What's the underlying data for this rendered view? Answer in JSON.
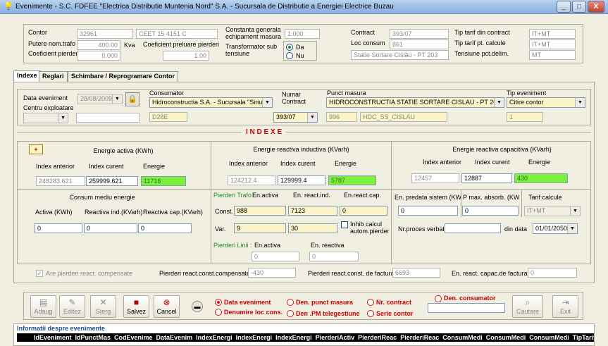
{
  "window": {
    "title": "Evenimente - S.C. FDFEE \"Electrica Distributie Muntenia Nord\" S.A. - Sucursala de Distributie a Energiei Electrice Buzau",
    "min": "_",
    "max": "□",
    "close": "X"
  },
  "top": {
    "contor_label": "Contor",
    "contor_value": "32961",
    "contor_desc": "CEET 15 4151 C",
    "putere_label": "Putere nom.trafo",
    "putere_value": "400.00",
    "putere_unit": "Kva",
    "coef_pierderi_label": "Coeficient pierderi",
    "coef_pierderi_value": "0.000",
    "coef_preluare_label": "Coeficient preluare pierderi",
    "coef_preluare_value": "1.00",
    "constanta_label": "Constanta generala echipament masura",
    "constanta_value": "1.000",
    "transformator_label": "Transformator sub tensiune",
    "da_label": "Da",
    "nu_label": "Nu",
    "contract_label": "Contract",
    "contract_value": "393/07",
    "loc_consum_label": "Loc consum",
    "loc_consum_value": "861",
    "loc_consum_desc": "Statie Sortare Cislău - PT 203",
    "tip_tarif_contract_label": "Tip tarif din contract",
    "tip_tarif_contract_value": "IT+MT",
    "tip_tarif_calcule_label": "Tip tarif pt. calcule",
    "tip_tarif_calcule_value": "IT+MT",
    "tensiune_label": "Tensiune pct.delim.",
    "tensiune_value": "MT"
  },
  "tabs": [
    "Indexe",
    "Reglari",
    "Schimbare / Reprogramare Contor"
  ],
  "event": {
    "data_label": "Data eveniment",
    "data_value": "28/08/2009",
    "centru_label": "Centru exploatare",
    "centru_value": "",
    "consumator_label": "Consumator",
    "consumator_value": "Hidroconstructia S.A. - Sucursala \"Siriu\"",
    "consumator_code": "D28E",
    "numar_contract_label": "Numar Contract",
    "numar_contract_value": "393/07",
    "contract_code": "996",
    "punct_label": "Punct masura",
    "punct_value": "HIDROCONSTRUCTIA STATIE SORTARE CISLAU - PT 203",
    "punct_code": "HDC_SS_CISLAU",
    "tip_label": "Tip eveniment",
    "tip_value": "Citire contor",
    "tip_code": "1"
  },
  "indexe": {
    "title": "I N D E X E",
    "plus": "+",
    "activa_title": "Energie activa (KWh)",
    "inductiva_title": "Energie reactiva inductiva (KVarh)",
    "capacitiva_title": "Energie reactiva capacitiva (KVarh)",
    "col_anterior": "Index anterior",
    "col_curent": "Index curent",
    "col_energie": "Energie",
    "activa": {
      "anterior": "248283.621",
      "curent": "259999.621",
      "energie": "11716"
    },
    "inductiva": {
      "anterior": "124212.4",
      "curent": "129999.4",
      "energie": "5787"
    },
    "capacitiva": {
      "anterior": "12457",
      "curent": "12887",
      "energie": "430"
    }
  },
  "consum": {
    "title": "Consum mediu energie",
    "activa_label": "Activa (KWh)",
    "inductiva_label": "Reactiva ind.(KVarh)",
    "capacitiva_label": "Reactiva cap.(KVarh)",
    "activa": "0",
    "inductiva": "0",
    "capacitiva": "0"
  },
  "pierderi": {
    "trafo_label": "Pierderi Trafo :",
    "en_activa": "En.activa",
    "en_react_ind": "En. react.ind.",
    "en_react_cap": "En.react.cap.",
    "const_label": "Const.",
    "const_activa": "988",
    "const_ind": "7123",
    "const_cap": "0",
    "var_label": "Var.",
    "var_activa": "9",
    "var_ind": "30",
    "inhib_label": "Inhib calcul autom.pierder",
    "linii_label": "Pierderi Linii :",
    "linii_activa_label": "En.activa",
    "linii_reactiva_label": "En. reactiva",
    "linii_activa": "0",
    "linii_reactiva": "0"
  },
  "capright": {
    "predata_label": "En. predata sistem (KWh)",
    "pmax_label": "P max. absorb. (KW)",
    "tarif_label": "Tarif calcule",
    "predata": "0",
    "pmax": "0",
    "tarif": "IT+MT",
    "proces_label": "Nr.proces verbal",
    "proces": "",
    "din_data_label": "din data",
    "din_data": "01/01/2050"
  },
  "bottom_row": {
    "compensate_label": "Are pierderi react. compensate",
    "const_comp_label": "Pierderi react.const.compensate",
    "const_comp_value": "-430",
    "facturat_label": "Pierderi react.const. de facturat",
    "facturat_value": "6693",
    "capac_label": "En. react. capac.de  facturat",
    "capac_value": "0"
  },
  "toolbar": {
    "adaug": "Adaug",
    "editez": "Editez",
    "sterg": "Sterg",
    "salvez": "Salvez",
    "cancel": "Cancel",
    "cautare": "Cautare",
    "exit": "Exit"
  },
  "search": {
    "data_eveniment": "Data eveniment",
    "den_punct": "Den. punct masura",
    "nr_contract": "Nr. contract",
    "den_consumator": "Den. consumator",
    "denumire_loc": "Denumire loc cons.",
    "den_pm": "Den .PM telegestiune",
    "serie_contor": "Serie contor",
    "value": ""
  },
  "info": {
    "title": "Informatii despre evenimente",
    "columns": [
      "IdEveniment",
      "IdPunctMas",
      "CodEvenime",
      "DataEvenim",
      "IndexEnergi",
      "IndexEnergi",
      "IndexEnergi",
      "PierderiActiv",
      "PierderiReac",
      "PierderiReac",
      "ConsumMedi",
      "ConsumMedi",
      "ConsumMedi",
      "TipTarif"
    ]
  },
  "colors": {
    "green_field": "#7CF03C",
    "yellow_field": "#FBF4C8",
    "accent_red": "#CC0000"
  }
}
